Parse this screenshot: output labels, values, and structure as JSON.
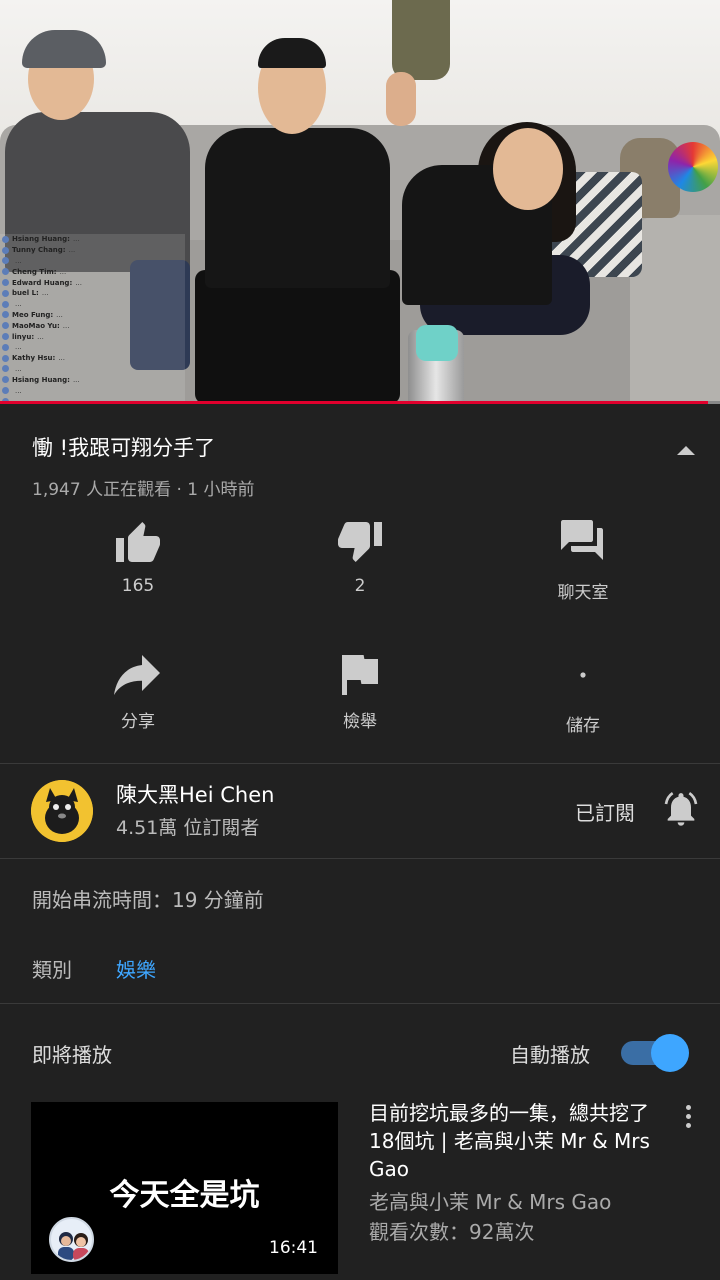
{
  "player": {
    "chat": [
      {
        "name": "Hsiang Huang:",
        "msg": "..."
      },
      {
        "name": "Tunny Chang:",
        "msg": "..."
      },
      {
        "name": "",
        "msg": "..."
      },
      {
        "name": "Cheng Tim:",
        "msg": "..."
      },
      {
        "name": "Edward Huang:",
        "msg": "..."
      },
      {
        "name": "buel L:",
        "msg": "..."
      },
      {
        "name": "",
        "msg": "..."
      },
      {
        "name": "Meo Fung:",
        "msg": "..."
      },
      {
        "name": "MaoMao Yu:",
        "msg": "..."
      },
      {
        "name": "linyu:",
        "msg": "..."
      },
      {
        "name": "",
        "msg": "..."
      },
      {
        "name": "Kathy Hsu:",
        "msg": "..."
      },
      {
        "name": "",
        "msg": "..."
      },
      {
        "name": "Hsiang Huang:",
        "msg": "..."
      },
      {
        "name": "",
        "msg": "..."
      },
      {
        "name": "",
        "msg": "..."
      }
    ],
    "progress_fraction": 0.983
  },
  "video": {
    "title": "慟 !我跟可翔分手了",
    "meta": "1,947 人正在觀看 · 1 小時前"
  },
  "actions": {
    "like_count": "165",
    "dislike_count": "2",
    "chat_label": "聊天室",
    "share_label": "分享",
    "report_label": "檢舉",
    "save_label": "儲存"
  },
  "channel": {
    "name": "陳大黑Hei Chen",
    "subscribers": "4.51萬 位訂閱者",
    "subscribed_label": "已訂閱"
  },
  "details": {
    "stream_started": "開始串流時間：19 分鐘前",
    "category_label": "類別",
    "category_value": "娛樂"
  },
  "up_next": {
    "label": "即將播放",
    "autoplay_label": "自動播放",
    "autoplay_on": true,
    "video": {
      "thumbnail_text": "今天全是坑",
      "duration": "16:41",
      "title": "目前挖坑最多的一集，總共挖了18個坑 | 老高與小茉 Mr & Mrs Gao",
      "channel": "老高與小茉 Mr & Mrs Gao",
      "views": "觀看次數：92萬次"
    }
  },
  "colors": {
    "background": "#212121",
    "accent_blue": "#3ea6ff",
    "progress_red": "#e1002d"
  }
}
